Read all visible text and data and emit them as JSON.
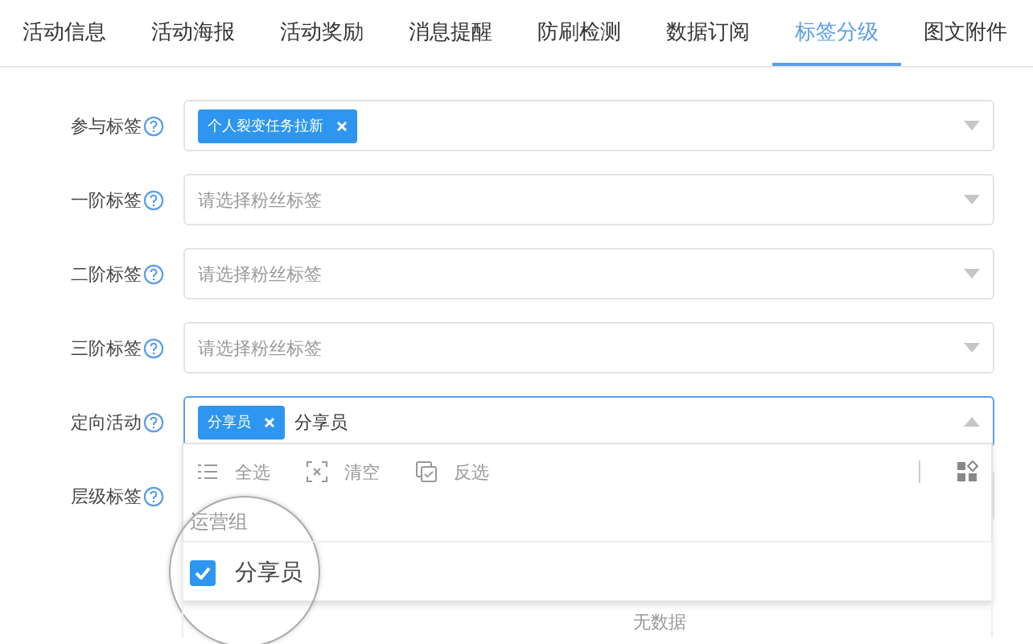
{
  "tabs": [
    {
      "label": "活动信息",
      "selected": false
    },
    {
      "label": "活动海报",
      "selected": false
    },
    {
      "label": "活动奖励",
      "selected": false
    },
    {
      "label": "消息提醒",
      "selected": false
    },
    {
      "label": "防刷检测",
      "selected": false
    },
    {
      "label": "数据订阅",
      "selected": false
    },
    {
      "label": "标签分级",
      "selected": true
    },
    {
      "label": "图文附件",
      "selected": false
    }
  ],
  "fields": [
    {
      "label": "参与标签",
      "tags": [
        "个人裂变任务拉新"
      ],
      "expanded": false
    },
    {
      "label": "一阶标签",
      "placeholder": "请选择粉丝标签",
      "expanded": false
    },
    {
      "label": "二阶标签",
      "placeholder": "请选择粉丝标签",
      "expanded": false
    },
    {
      "label": "三阶标签",
      "placeholder": "请选择粉丝标签",
      "expanded": false
    },
    {
      "label": "定向活动",
      "tags": [
        "分享员"
      ],
      "value": "分享员",
      "expanded": true
    },
    {
      "label": "层级标签",
      "expanded": false
    }
  ],
  "dropdown": {
    "actions": [
      {
        "kind": "select-all",
        "label": "全选"
      },
      {
        "kind": "clear",
        "label": "清空"
      },
      {
        "kind": "invert",
        "label": "反选"
      }
    ],
    "group": "运营组",
    "options": [
      {
        "label": "分享员",
        "checked": true
      }
    ]
  },
  "empty_text": "无数据"
}
